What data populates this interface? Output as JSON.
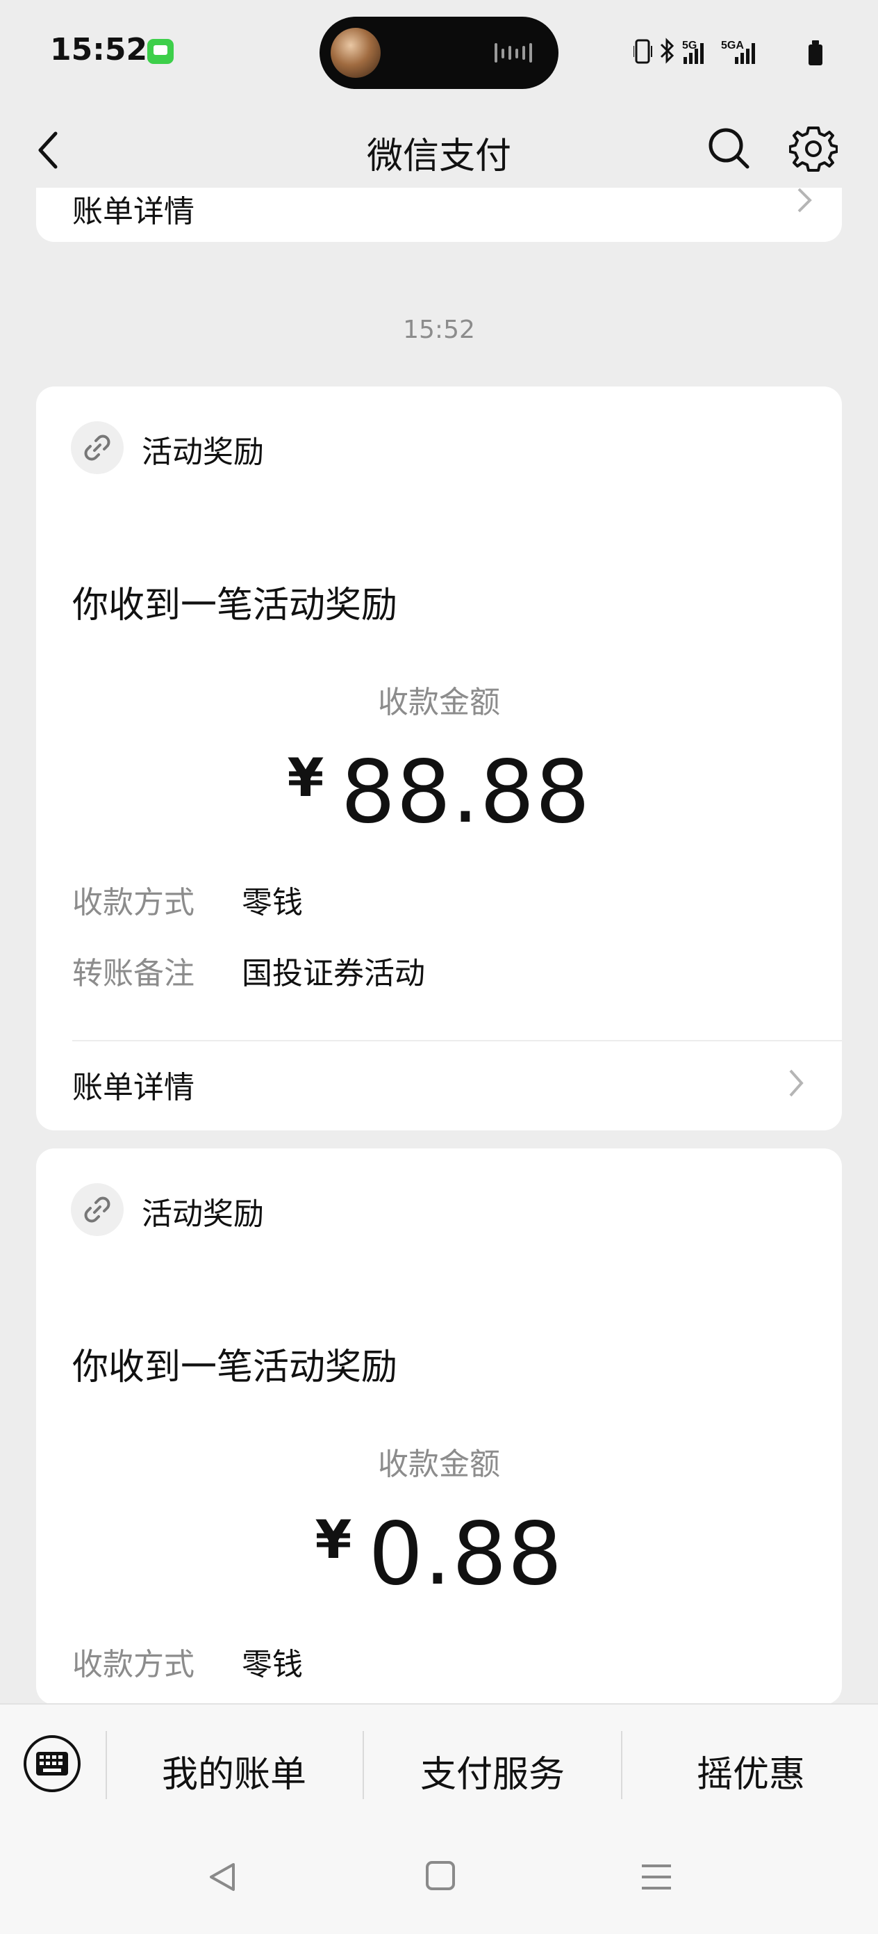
{
  "status_bar": {
    "time": "15:52",
    "network_label_1": "5G",
    "network_label_2": "5GA"
  },
  "header": {
    "title": "微信支付",
    "back_icon": "back-arrow-icon",
    "search_icon": "search-icon",
    "settings_icon": "gear-icon"
  },
  "partial_card": {
    "detail_label": "账单详情"
  },
  "timestamp": "15:52",
  "cards": [
    {
      "head_title": "活动奖励",
      "message": "你收到一笔活动奖励",
      "amount_label": "收款金额",
      "currency": "¥",
      "amount": "88.88",
      "rows": [
        {
          "key": "收款方式",
          "value": "零钱"
        },
        {
          "key": "转账备注",
          "value": "国投证券活动"
        }
      ],
      "detail_label": "账单详情"
    },
    {
      "head_title": "活动奖励",
      "message": "你收到一笔活动奖励",
      "amount_label": "收款金额",
      "currency": "¥",
      "amount": "0.88",
      "rows": [
        {
          "key": "收款方式",
          "value": "零钱"
        }
      ]
    }
  ],
  "toolbar": {
    "keyboard_icon": "keyboard-icon",
    "items": [
      "我的账单",
      "支付服务",
      "摇优惠"
    ]
  },
  "system_nav": {
    "back_icon": "triangle-back-icon",
    "home_icon": "square-home-icon",
    "menu_icon": "three-lines-menu-icon"
  }
}
